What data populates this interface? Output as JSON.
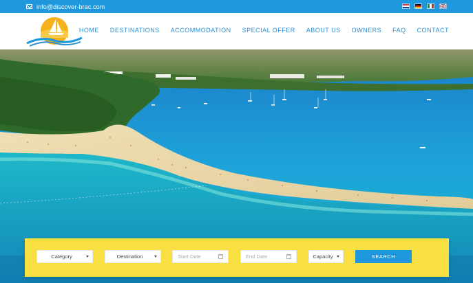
{
  "topbar": {
    "email": "info@discover-brac.com",
    "languages": [
      "hr",
      "de",
      "it",
      "en"
    ]
  },
  "nav": {
    "items": [
      "HOME",
      "DESTINATIONS",
      "ACCOMMODATION",
      "SPECIAL OFFER",
      "ABOUT US",
      "OWNERS",
      "FAQ",
      "CONTACT"
    ]
  },
  "search": {
    "category": "Category",
    "destination": "Destination",
    "start_date": "Start Date",
    "end_date": "End Date",
    "capacity": "Capacity",
    "button": "SEARCH"
  },
  "colors": {
    "primary_blue": "#1f97dd",
    "nav_text": "#2d8fcf",
    "search_panel": "#f8e042",
    "logo_sun": "#f6b21b"
  }
}
